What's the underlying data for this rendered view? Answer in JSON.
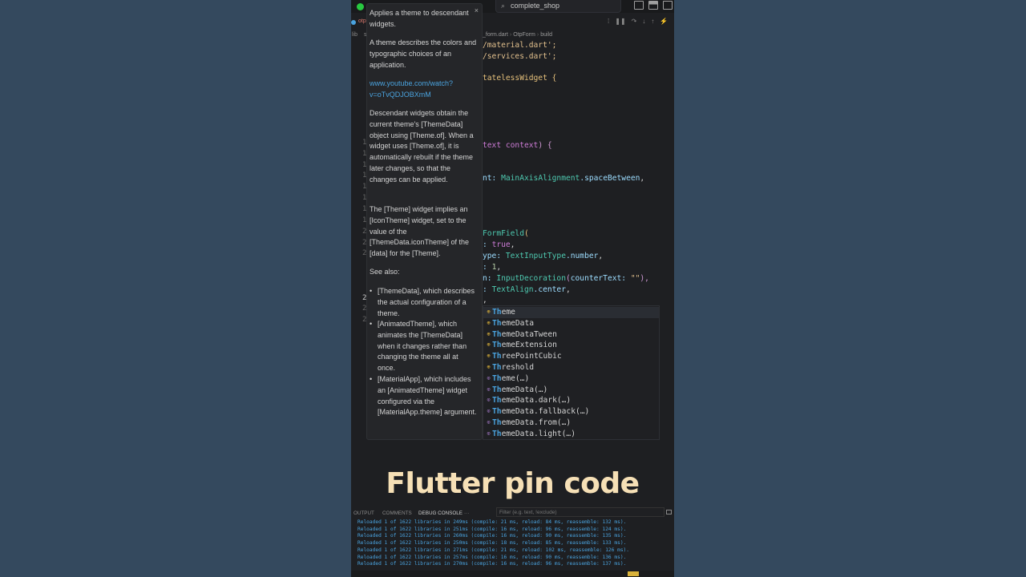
{
  "window": {
    "search_text": "complete_shop",
    "tab_label": "otp",
    "explorer_label": "lib",
    "explorer_sub": "s"
  },
  "breadcrumb": [
    "_form.dart",
    "OtpForm",
    "build"
  ],
  "gutter": [
    "1",
    "1",
    "1",
    "1",
    "1",
    "1",
    "1",
    "1",
    "2",
    "2",
    "2",
    "2",
    "2",
    "2"
  ],
  "hover_doc": {
    "p1": "Applies a theme to descendant widgets.",
    "p2": "A theme describes the colors and typographic choices of an application.",
    "link": "www.youtube.com/watch?v=oTvQDJOBXmM",
    "p3": "Descendant widgets obtain the current theme's [ThemeData] object using [Theme.of]. When a widget uses [Theme.of], it is automatically rebuilt if the theme later changes, so that the changes can be applied.",
    "p4": "The [Theme] widget implies an [IconTheme] widget, set to the value of the [ThemeData.iconTheme] of the [data] for the [Theme].",
    "see_also": "See also:",
    "bullets": [
      "[ThemeData], which describes the actual configuration of a theme.",
      "[AnimatedTheme], which animates the [ThemeData] when it changes rather than changing the theme all at once.",
      "[MaterialApp], which includes an [AnimatedTheme] widget configured via the [MaterialApp.theme] argument."
    ]
  },
  "code": {
    "l1": "/material.dart';",
    "l2": "/services.dart';",
    "l3a": "tatelessWidget",
    "l3b": " {",
    "l4a": "text context",
    "l4b": ") {",
    "l5a": "nt: ",
    "l5b": "MainAxisAlignment",
    "l5c": ".spaceBetween",
    "l5d": ",",
    "l6a": "FormField",
    "l6b": "(",
    "l7a": ": ",
    "l7b": "true",
    "l7c": ",",
    "l8a": "ype: ",
    "l8b": "TextInputType",
    "l8c": ".number",
    "l8d": ",",
    "l9a": ": ",
    "l9b": "1",
    "l9c": ",",
    "l10a": "n: ",
    "l10b": "InputDecoration",
    "l10c": "(",
    "l10d": "counterText: ",
    "l10e": "\"\"",
    "l10f": "),",
    "l11a": ": ",
    "l11b": "TextAlign",
    "l11c": ".center",
    "l11d": ",",
    "l12": ","
  },
  "suggestions": [
    {
      "hl": "Th",
      "rest": "eme",
      "icon": "class"
    },
    {
      "hl": "Th",
      "rest": "emeData",
      "icon": "class"
    },
    {
      "hl": "Th",
      "rest": "emeDataTween",
      "icon": "class"
    },
    {
      "hl": "Th",
      "rest": "emeExtension",
      "icon": "class"
    },
    {
      "hl": "Th",
      "rest": "reePointCubic",
      "icon": "class"
    },
    {
      "hl": "Th",
      "rest": "reshold",
      "icon": "class"
    },
    {
      "hl": "Th",
      "rest": "eme(…)",
      "icon": "method"
    },
    {
      "hl": "Th",
      "rest": "emeData(…)",
      "icon": "method"
    },
    {
      "hl": "Th",
      "rest": "emeData.dark(…)",
      "icon": "method"
    },
    {
      "hl": "Th",
      "rest": "emeData.fallback(…)",
      "icon": "method"
    },
    {
      "hl": "Th",
      "rest": "emeData.from(…)",
      "icon": "method"
    },
    {
      "hl": "Th",
      "rest": "emeData.light(…)",
      "icon": "method"
    }
  ],
  "overlay_title": "Flutter pin code",
  "panel": {
    "tabs": [
      "OUTPUT",
      "COMMENTS",
      "DEBUG CONSOLE",
      "···"
    ],
    "filter_placeholder": "Filter (e.g. text, !exclude)"
  },
  "console_lines": [
    "Reloaded 1 of 1622 libraries in 249ms (compile: 21 ms, reload: 84 ms, reassemble: 132 ms).",
    "Reloaded 1 of 1622 libraries in 251ms (compile: 16 ms, reload: 96 ms, reassemble: 124 ms).",
    "Reloaded 1 of 1622 libraries in 260ms (compile: 16 ms, reload: 90 ms, reassemble: 135 ms).",
    "Reloaded 1 of 1622 libraries in 250ms (compile: 18 ms, reload: 85 ms, reassemble: 133 ms).",
    "Reloaded 1 of 1622 libraries in 271ms (compile: 21 ms, reload: 102 ms, reassemble: 126 ms).",
    "Reloaded 1 of 1622 libraries in 257ms (compile: 16 ms, reload: 90 ms, reassemble: 136 ms).",
    "Reloaded 1 of 1622 libraries in 270ms (compile: 16 ms, reload: 96 ms, reassemble: 137 ms)."
  ]
}
